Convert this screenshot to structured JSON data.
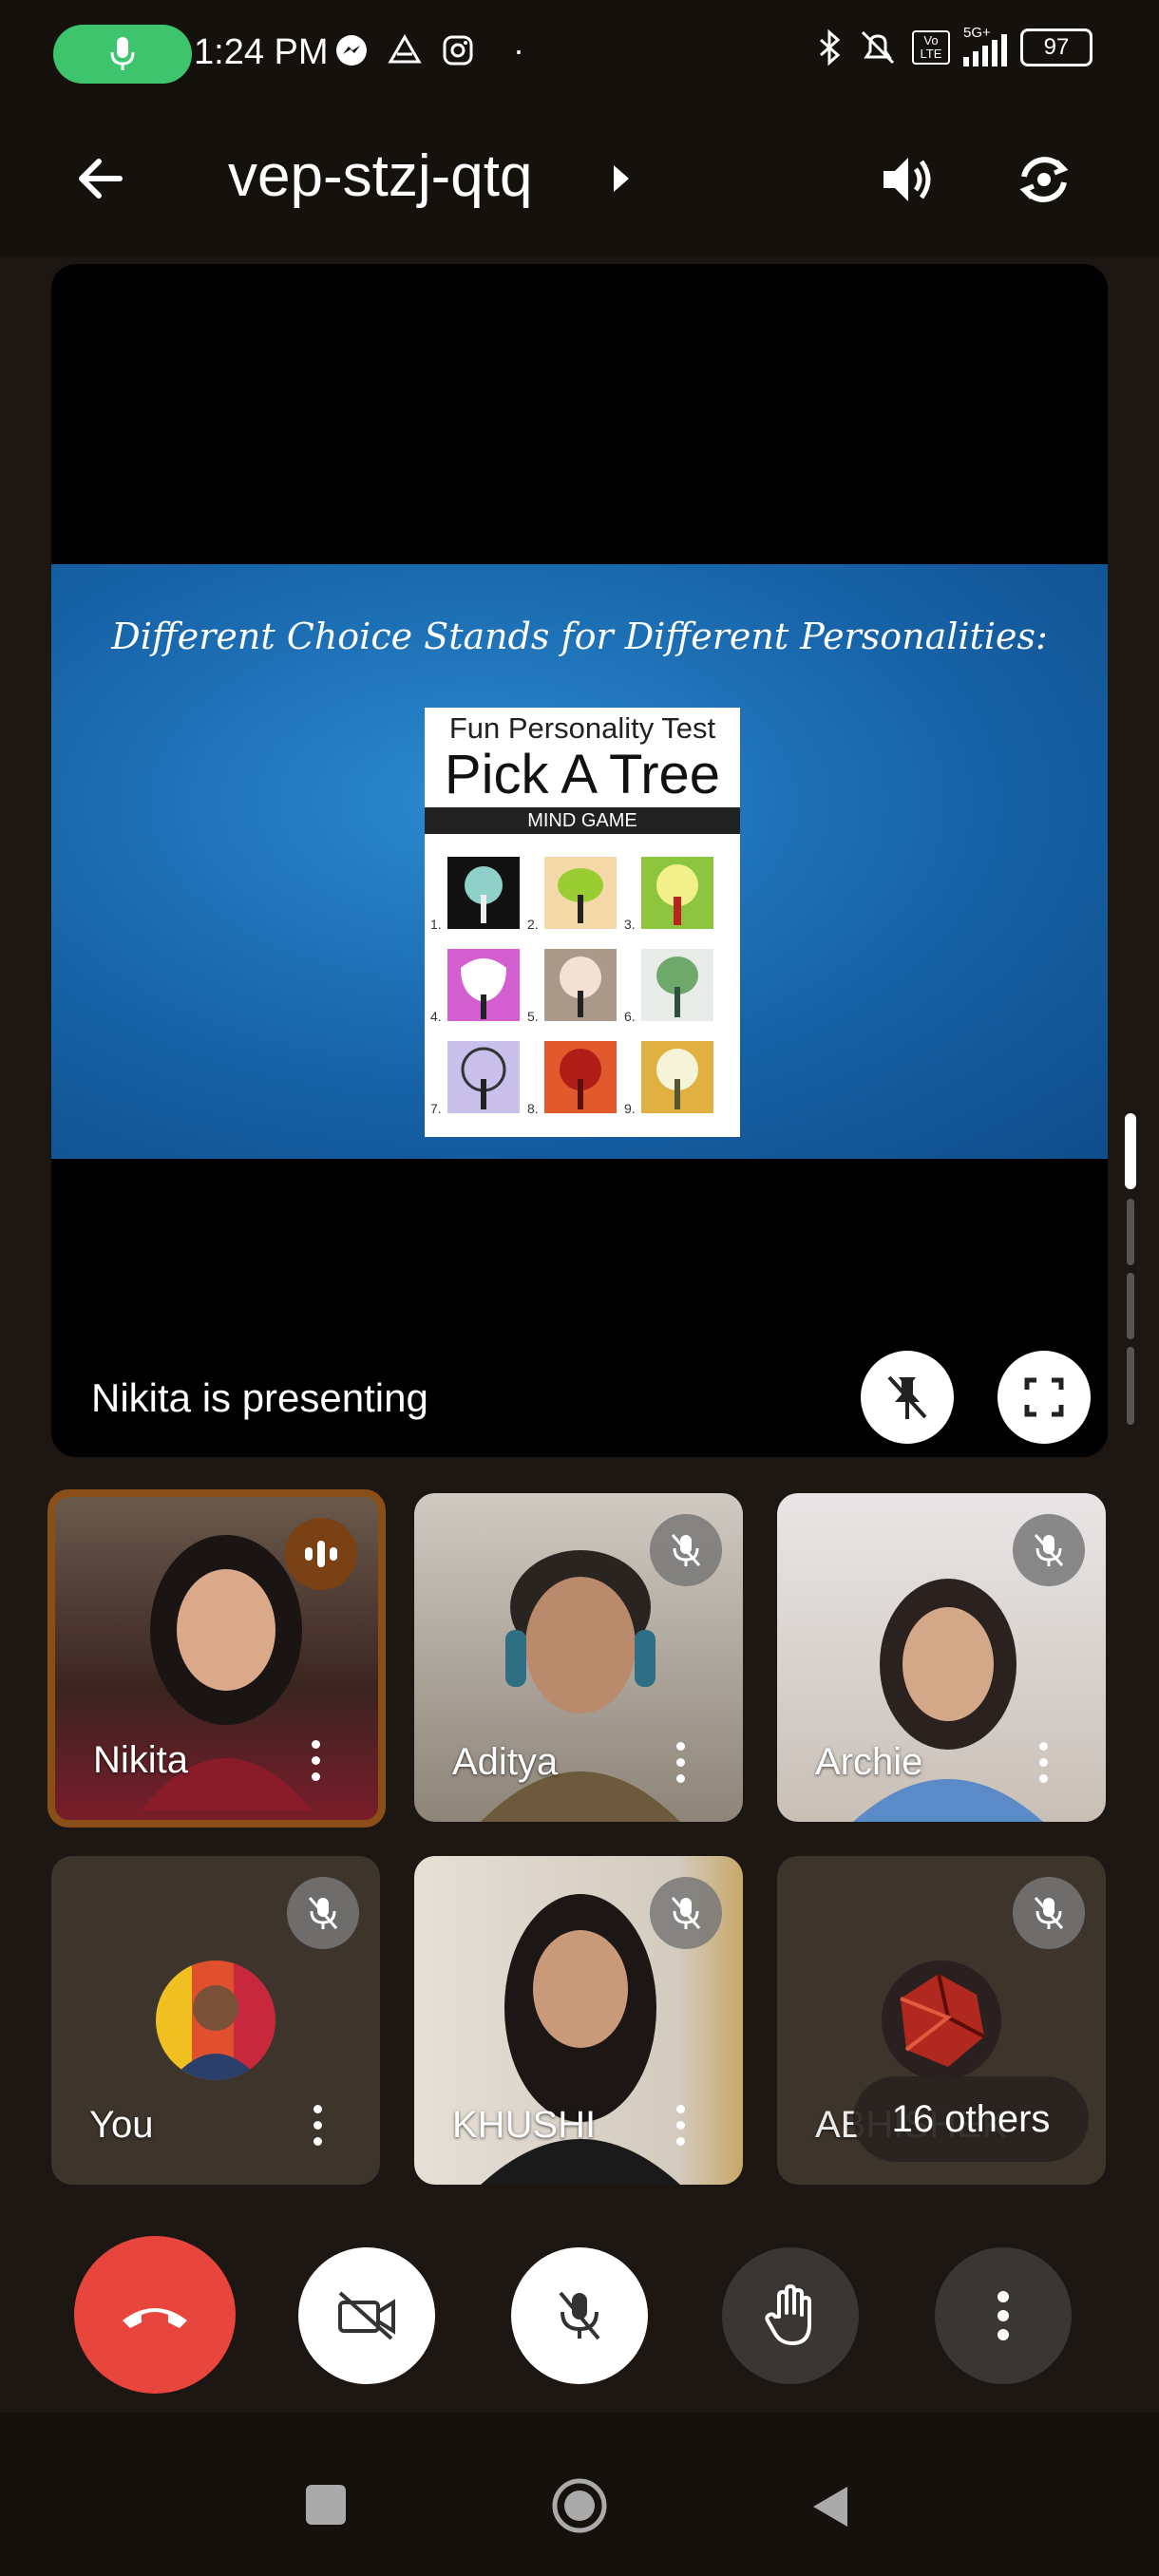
{
  "status_bar": {
    "time": "1:24 PM",
    "network": "5G+",
    "volte": "Vo LTE",
    "battery": "97"
  },
  "header": {
    "meeting_code": "vep-stzj-qtq"
  },
  "presentation": {
    "slide_heading": "Different Choice Stands for Different Personalities:",
    "poster_subtitle": "Fun Personality Test",
    "poster_title": "Pick A Tree",
    "poster_band": "MIND GAME",
    "tree_numbers": [
      "1.",
      "2.",
      "3.",
      "4.",
      "5.",
      "6.",
      "7.",
      "8.",
      "9."
    ],
    "presenter_status": "Nikita  is presenting"
  },
  "participants": [
    {
      "name": "Nikita",
      "state": "speaking"
    },
    {
      "name": "Aditya",
      "state": "muted"
    },
    {
      "name": "Archie",
      "state": "muted"
    },
    {
      "name": "You",
      "state": "muted"
    },
    {
      "name": "KHUSHI",
      "state": "muted"
    },
    {
      "name": "ABHISHEK",
      "state": "muted"
    }
  ],
  "others_label": "16 others",
  "colors": {
    "end_call": "#e8453c",
    "mic_active": "#3ec46d",
    "speaking_border": "#8a4f18"
  }
}
